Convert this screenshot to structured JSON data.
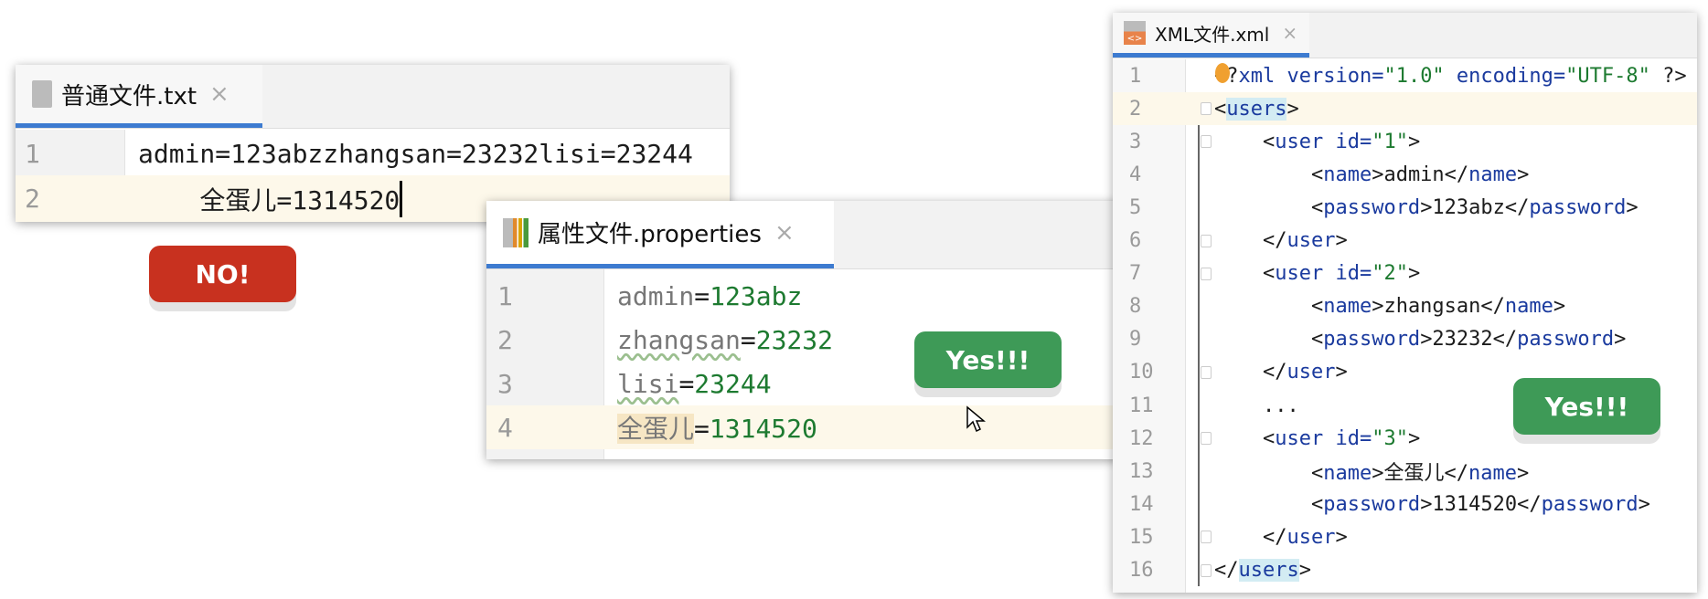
{
  "txt_panel": {
    "tab_label": "普通文件.txt",
    "close": "×",
    "lines": [
      {
        "num": "1",
        "text": "admin=123abzzhangsan=23232lisi=23244"
      },
      {
        "num": "2",
        "text": "    全蛋儿=1314520"
      }
    ]
  },
  "no_badge": "NO!",
  "props_panel": {
    "tab_label": "属性文件.properties",
    "close": "×",
    "lines": [
      {
        "num": "1",
        "key": "admin",
        "eq": "=",
        "value": "123abz"
      },
      {
        "num": "2",
        "key": "zhangsan",
        "eq": "=",
        "value": "23232"
      },
      {
        "num": "3",
        "key": "lisi",
        "eq": "=",
        "value": "23244"
      },
      {
        "num": "4",
        "key": "全蛋儿",
        "eq": "=",
        "value": "1314520"
      }
    ]
  },
  "yes_badge_1": "Yes!!!",
  "yes_badge_2": "Yes!!!",
  "xml_panel": {
    "tab_label": "XML文件.xml",
    "close": "×",
    "lines": [
      {
        "num": "1",
        "segs": [
          [
            "<?",
            "p"
          ],
          [
            "xml version=",
            "t"
          ],
          [
            "\"1.0\"",
            "g"
          ],
          [
            " encoding=",
            "t"
          ],
          [
            "\"UTF-8\"",
            "g"
          ],
          [
            " ?>",
            "p"
          ]
        ]
      },
      {
        "num": "2",
        "segs": [
          [
            "<",
            "p"
          ],
          [
            "users",
            "t"
          ],
          [
            ">",
            "p"
          ]
        ]
      },
      {
        "num": "3",
        "segs": [
          [
            "    <",
            "p"
          ],
          [
            "user ",
            "t"
          ],
          [
            "id=",
            "t"
          ],
          [
            "\"1\"",
            "g"
          ],
          [
            ">",
            "p"
          ]
        ]
      },
      {
        "num": "4",
        "segs": [
          [
            "        <",
            "p"
          ],
          [
            "name",
            "t"
          ],
          [
            ">admin</",
            "p"
          ],
          [
            "name",
            "t"
          ],
          [
            ">",
            "p"
          ]
        ]
      },
      {
        "num": "5",
        "segs": [
          [
            "        <",
            "p"
          ],
          [
            "password",
            "t"
          ],
          [
            ">123abz</",
            "p"
          ],
          [
            "password",
            "t"
          ],
          [
            ">",
            "p"
          ]
        ]
      },
      {
        "num": "6",
        "segs": [
          [
            "    </",
            "p"
          ],
          [
            "user",
            "t"
          ],
          [
            ">",
            "p"
          ]
        ]
      },
      {
        "num": "7",
        "segs": [
          [
            "    <",
            "p"
          ],
          [
            "user ",
            "t"
          ],
          [
            "id=",
            "t"
          ],
          [
            "\"2\"",
            "g"
          ],
          [
            ">",
            "p"
          ]
        ]
      },
      {
        "num": "8",
        "segs": [
          [
            "        <",
            "p"
          ],
          [
            "name",
            "t"
          ],
          [
            ">zhangsan</",
            "p"
          ],
          [
            "name",
            "t"
          ],
          [
            ">",
            "p"
          ]
        ]
      },
      {
        "num": "9",
        "segs": [
          [
            "        <",
            "p"
          ],
          [
            "password",
            "t"
          ],
          [
            ">23232</",
            "p"
          ],
          [
            "password",
            "t"
          ],
          [
            ">",
            "p"
          ]
        ]
      },
      {
        "num": "10",
        "segs": [
          [
            "    </",
            "p"
          ],
          [
            "user",
            "t"
          ],
          [
            ">",
            "p"
          ]
        ]
      },
      {
        "num": "11",
        "segs": [
          [
            "    ...",
            "p"
          ]
        ]
      },
      {
        "num": "12",
        "segs": [
          [
            "    <",
            "p"
          ],
          [
            "user ",
            "t"
          ],
          [
            "id=",
            "t"
          ],
          [
            "\"3\"",
            "g"
          ],
          [
            ">",
            "p"
          ]
        ]
      },
      {
        "num": "13",
        "segs": [
          [
            "        <",
            "p"
          ],
          [
            "name",
            "t"
          ],
          [
            ">全蛋儿</",
            "p"
          ],
          [
            "name",
            "t"
          ],
          [
            ">",
            "p"
          ]
        ]
      },
      {
        "num": "14",
        "segs": [
          [
            "        <",
            "p"
          ],
          [
            "password",
            "t"
          ],
          [
            ">1314520</",
            "p"
          ],
          [
            "password",
            "t"
          ],
          [
            ">",
            "p"
          ]
        ]
      },
      {
        "num": "15",
        "segs": [
          [
            "    </",
            "p"
          ],
          [
            "user",
            "t"
          ],
          [
            ">",
            "p"
          ]
        ]
      },
      {
        "num": "16",
        "segs": [
          [
            "</",
            "p"
          ],
          [
            "users",
            "t"
          ],
          [
            ">",
            "p"
          ]
        ]
      }
    ]
  }
}
